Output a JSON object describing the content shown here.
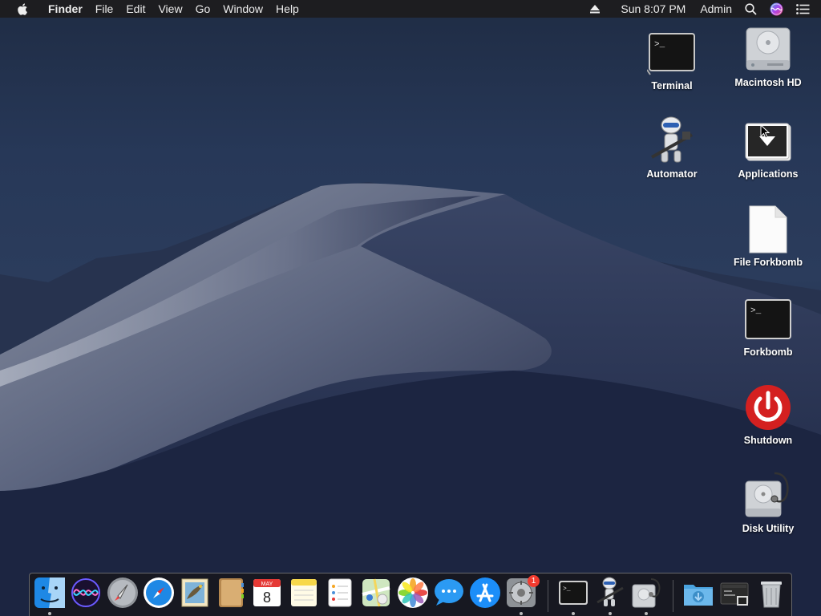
{
  "menubar": {
    "app_name": "Finder",
    "menus": [
      "File",
      "Edit",
      "View",
      "Go",
      "Window",
      "Help"
    ],
    "clock": "Sun 8:07 PM",
    "user": "Admin",
    "status_icons": [
      "eject-icon",
      "search-icon",
      "siri-icon",
      "notification-center-icon"
    ]
  },
  "desktop": {
    "icons": [
      {
        "label": "Terminal",
        "icon": "terminal-icon"
      },
      {
        "label": "Macintosh HD",
        "icon": "hard-drive-icon"
      },
      {
        "label": "Automator",
        "icon": "automator-icon"
      },
      {
        "label": "Applications",
        "icon": "applications-folder-icon"
      },
      {
        "label": "File Forkbomb",
        "icon": "document-icon"
      },
      {
        "label": "Forkbomb",
        "icon": "terminal-icon"
      },
      {
        "label": "Shutdown",
        "icon": "power-icon"
      },
      {
        "label": "Disk Utility",
        "icon": "disk-utility-icon"
      }
    ]
  },
  "dock": {
    "items": [
      {
        "icon": "finder-icon",
        "running": true
      },
      {
        "icon": "siri-icon",
        "running": false
      },
      {
        "icon": "launchpad-icon",
        "running": false
      },
      {
        "icon": "safari-icon",
        "running": false
      },
      {
        "icon": "mail-icon",
        "running": false
      },
      {
        "icon": "contacts-icon",
        "running": false
      },
      {
        "icon": "calendar-icon",
        "running": false,
        "month": "MAY",
        "day": "8"
      },
      {
        "icon": "notes-icon",
        "running": false
      },
      {
        "icon": "reminders-icon",
        "running": false
      },
      {
        "icon": "maps-icon",
        "running": false
      },
      {
        "icon": "photos-icon",
        "running": false
      },
      {
        "icon": "messages-icon",
        "running": false
      },
      {
        "icon": "app-store-icon",
        "running": false
      },
      {
        "icon": "system-preferences-icon",
        "running": true,
        "badge": "1"
      },
      {
        "icon": "terminal-icon",
        "running": true
      },
      {
        "icon": "automator-icon",
        "running": true
      },
      {
        "icon": "disk-utility-icon",
        "running": true
      },
      {
        "icon": "downloads-folder-icon",
        "running": false
      },
      {
        "icon": "recent-stack-icon",
        "running": false
      },
      {
        "icon": "trash-icon",
        "running": false
      }
    ]
  },
  "colors": {
    "menubar_bg": "#1d1d20",
    "shutdown_red": "#d42020",
    "badge_red": "#f23b2f"
  }
}
